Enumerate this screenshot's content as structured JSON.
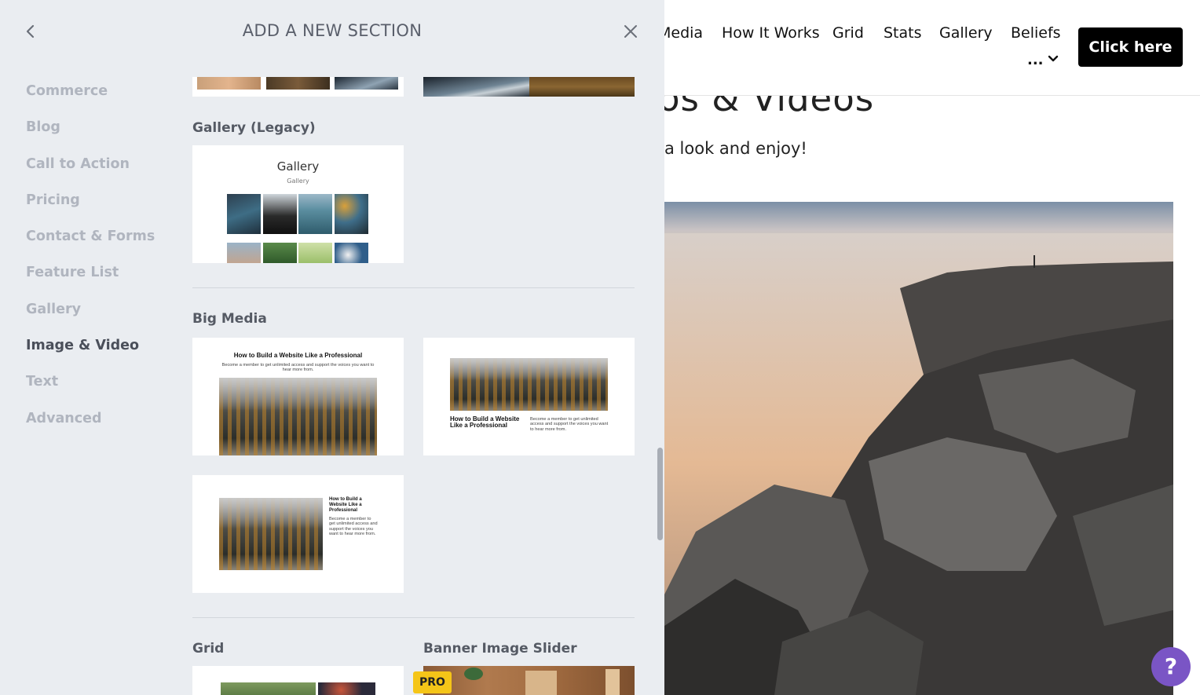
{
  "panel": {
    "title": "ADD A NEW SECTION",
    "back_icon": "chevron-left-icon",
    "close_icon": "close-icon",
    "categories": [
      {
        "label": "Commerce",
        "active": false
      },
      {
        "label": "Blog",
        "active": false
      },
      {
        "label": "Call to Action",
        "active": false
      },
      {
        "label": "Pricing",
        "active": false
      },
      {
        "label": "Contact & Forms",
        "active": false
      },
      {
        "label": "Feature List",
        "active": false
      },
      {
        "label": "Gallery",
        "active": false
      },
      {
        "label": "Image & Video",
        "active": true
      },
      {
        "label": "Text",
        "active": false
      },
      {
        "label": "Advanced",
        "active": false
      }
    ],
    "groups": {
      "gallery_legacy": {
        "title": "Gallery (Legacy)",
        "preview_title": "Gallery",
        "preview_subtitle": "Gallery"
      },
      "big_media": {
        "title": "Big Media",
        "card1": {
          "heading": "How to Build a Website Like a Professional",
          "body": "Become a member to get unlimited access and support the voices you want to hear more from."
        },
        "card2": {
          "heading": "How to Build a Website Like a Professional",
          "body": "Become a member to get unlimited access and support the voices you want to hear more from."
        },
        "card3": {
          "heading": "How to Build a Website Like a Professional",
          "body": "Become a member to get unlimited access and support the voices you want to hear more from."
        }
      },
      "grid": {
        "title": "Grid"
      },
      "banner_image_slider": {
        "title": "Banner Image Slider",
        "badge": "PRO"
      }
    }
  },
  "site": {
    "nav": [
      "Media",
      "How It Works",
      "Grid",
      "Stats",
      "Gallery",
      "Beliefs"
    ],
    "more_label": "...",
    "cta": "Click here",
    "heading": "os & Videos",
    "subheading": "a look and enjoy!"
  },
  "help": {
    "label": "?"
  }
}
